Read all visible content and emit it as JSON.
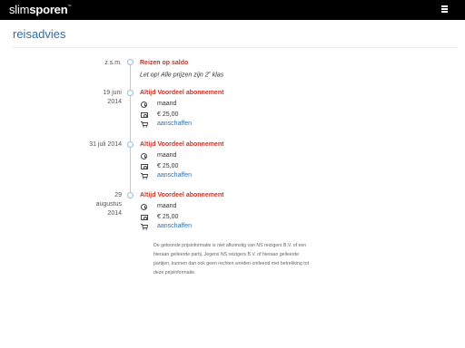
{
  "brand": {
    "light": "slim",
    "bold": "sporen",
    "mark": "™"
  },
  "page_title": "reisadvies",
  "events": [
    {
      "date_lines": [
        "z.s.m."
      ],
      "title": "Reizen op saldo",
      "note": "Let op! Alle prijzen zijn 2",
      "note_sup": "e",
      "note_tail": " klas"
    },
    {
      "date_lines": [
        "19 juni",
        "2014"
      ],
      "title": "Altijd Voordeel abonnement",
      "period": "maand",
      "price": "€ 25,00",
      "action": "aanschaffen"
    },
    {
      "date_lines": [
        "31 juli 2014"
      ],
      "title": "Altijd Voordeel abonnement",
      "period": "maand",
      "price": "€ 25,00",
      "action": "aanschaffen"
    },
    {
      "date_lines": [
        "29",
        "augustus",
        "2014"
      ],
      "title": "Altijd Voordeel abonnement",
      "period": "maand",
      "price": "€ 25,00",
      "action": "aanschaffen"
    }
  ],
  "disclaimer": "De getoonde prijsinformatie is niet afkomstig van NS reizigers B.V. of een hieraan gelieerde partij. Jegens NS reizigers B.V. of hieraan gelieerde partijen, kunnen dan ook geen rechten worden ontleend met betrekking tot deze prijsinformatie.",
  "icons": [
    "menu-icon",
    "clock-icon",
    "cash-icon",
    "cart-icon"
  ],
  "colors": {
    "topbar": "#000000",
    "title": "#2f6fa7",
    "event_title": "#c7342a",
    "link": "#2f6fa7",
    "timeline": "#b8cde2"
  }
}
